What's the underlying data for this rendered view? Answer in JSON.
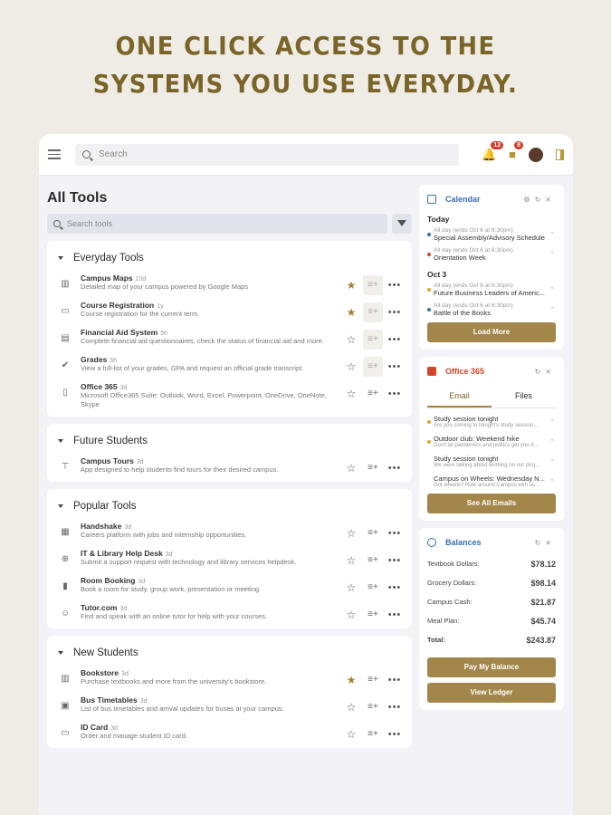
{
  "headline": {
    "line1": "ONE CLICK ACCESS TO THE",
    "line2": "SYSTEMS YOU USE EVERYDAY."
  },
  "topbar": {
    "search_placeholder": "Search",
    "notif_count": "12",
    "chat_count": "8"
  },
  "all_tools": {
    "title": "All Tools",
    "search_placeholder": "Search tools",
    "sections": [
      {
        "title": "Everyday Tools",
        "items": [
          {
            "name": "Campus Maps",
            "ago": "10d",
            "desc": "Detailed map of your campus powered by Google Maps",
            "icon": "map-icon",
            "glyph": "▥",
            "starred": true,
            "hl": true
          },
          {
            "name": "Course Registration",
            "ago": "1y",
            "desc": "Course registration for the current term.",
            "icon": "monitor-icon",
            "glyph": "▭",
            "starred": true,
            "hl": true
          },
          {
            "name": "Financial Aid System",
            "ago": "5h",
            "desc": "Complete financial aid questionnaires, check the status of financial aid and more.",
            "icon": "money-icon",
            "glyph": "▤",
            "starred": false,
            "hl": true
          },
          {
            "name": "Grades",
            "ago": "5h",
            "desc": "View a full-list of your grades, GPA and request an official grade transcript.",
            "icon": "check-circle-icon",
            "glyph": "✔",
            "starred": false,
            "hl": true
          },
          {
            "name": "Office 365",
            "ago": "3d",
            "desc": "Microsoft Office365 Suite: Outlook, Word, Excel, Powerpoint, OneDrive, OneNote, Skype",
            "icon": "office-icon",
            "glyph": "▯",
            "starred": false,
            "hl": false
          }
        ]
      },
      {
        "title": "Future Students",
        "items": [
          {
            "name": "Campus Tours",
            "ago": "3d",
            "desc": "App designed to help students find tours for their desired campus.",
            "icon": "signpost-icon",
            "glyph": "⊤",
            "starred": false,
            "hl": false
          }
        ]
      },
      {
        "title": "Popular Tools",
        "items": [
          {
            "name": "Handshake",
            "ago": "3d",
            "desc": "Careers platform with jobs and internship opportunities.",
            "icon": "briefcase-icon",
            "glyph": "▦",
            "starred": false,
            "hl": false
          },
          {
            "name": "IT & Library Help Desk",
            "ago": "3d",
            "desc": "Submit a support request with technology and library services helpdesk.",
            "icon": "help-desk-icon",
            "glyph": "⊕",
            "starred": false,
            "hl": false
          },
          {
            "name": "Room Booking",
            "ago": "3d",
            "desc": "Book a room for study, group work, presentation or meeting.",
            "icon": "room-icon",
            "glyph": "▮",
            "starred": false,
            "hl": false
          },
          {
            "name": "Tutor.com",
            "ago": "3d",
            "desc": "Find and speak with an online tutor for help with your courses.",
            "icon": "tutor-icon",
            "glyph": "☺",
            "starred": false,
            "hl": false
          }
        ]
      },
      {
        "title": "New Students",
        "items": [
          {
            "name": "Bookstore",
            "ago": "3d",
            "desc": "Purchase textbooks and more from the university's bookstore.",
            "icon": "book-icon",
            "glyph": "▥",
            "starred": true,
            "hl": false
          },
          {
            "name": "Bus Timetables",
            "ago": "3d",
            "desc": "List of bus timetables and arrival updates for buses at your campus.",
            "icon": "bus-icon",
            "glyph": "▣",
            "starred": false,
            "hl": false
          },
          {
            "name": "ID Card",
            "ago": "3d",
            "desc": "Order and manage student ID card.",
            "icon": "id-card-icon",
            "glyph": "▭",
            "starred": false,
            "hl": false
          }
        ]
      }
    ]
  },
  "calendar": {
    "title": "Calendar",
    "groups": [
      {
        "label": "Today",
        "events": [
          {
            "time": "All day (ends Oct 6 at 6:30pm)",
            "name": "Special Assembly/Advisory Schedule",
            "color": "#3a6fb0"
          },
          {
            "time": "All day (ends Oct 6 at 6:30pm)",
            "name": "Orientation Week",
            "color": "#d4462a"
          }
        ]
      },
      {
        "label": "Oct 3",
        "events": [
          {
            "time": "All day (ends Oct 6 at 6:30pm)",
            "name": "Future Business Leaders of Americ...",
            "color": "#e0a530"
          },
          {
            "time": "All day (ends Oct 6 at 6:30pm)",
            "name": "Battle of the Books",
            "color": "#3a6fb0"
          }
        ]
      }
    ],
    "button": "Load More"
  },
  "office": {
    "title": "Office 365",
    "tabs": [
      "Email",
      "Files"
    ],
    "emails": [
      {
        "subject": "Study session tonight",
        "preview": "Are you coming to tonight's study session...",
        "unread": true
      },
      {
        "subject": "Outdoor club: Weekend hike",
        "preview": "Don't let pandemics and politics get you d...",
        "unread": true
      },
      {
        "subject": "Study session tonight",
        "preview": "We were talking about working on our proj...",
        "unread": false
      },
      {
        "subject": "Campus on Wheels: Wednesday N...",
        "preview": "Got wheels? Ride around Campus with us...",
        "unread": false
      }
    ],
    "button": "See All Emails"
  },
  "balances": {
    "title": "Balances",
    "rows": [
      {
        "label": "Textbook Dollars:",
        "value": "$78.12"
      },
      {
        "label": "Grocery Dollars:",
        "value": "$98.14"
      },
      {
        "label": "Campus Cash:",
        "value": "$21.87"
      },
      {
        "label": "Meal Plan:",
        "value": "$45.74"
      },
      {
        "label": "Total:",
        "value": "$243.87"
      }
    ],
    "pay_button": "Pay My Balance",
    "ledger_button": "View Ledger"
  }
}
